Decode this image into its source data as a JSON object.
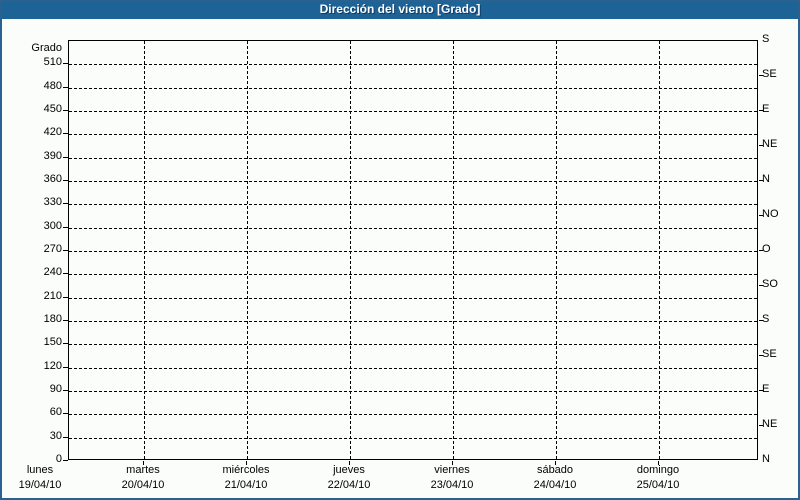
{
  "chart_data": {
    "type": "line",
    "title": "Dirección del viento [Grado]",
    "grid": "dashed",
    "legend": "none",
    "series": [],
    "y_axis": {
      "label": "Grado",
      "min": 0,
      "max": 540,
      "tick_step": 30,
      "tick_labels": [
        0,
        30,
        60,
        90,
        120,
        150,
        180,
        210,
        240,
        270,
        300,
        330,
        360,
        390,
        420,
        450,
        480,
        510
      ]
    },
    "y_axis_right": {
      "tick_step": 45,
      "labels_bottom_to_top": [
        "N",
        "NE",
        "E",
        "SE",
        "S",
        "SO",
        "O",
        "NO",
        "N",
        "NE",
        "E",
        "SE",
        "S"
      ]
    },
    "x_axis": {
      "days": [
        {
          "weekday": "lunes",
          "date": "19/04/10"
        },
        {
          "weekday": "martes",
          "date": "20/04/10"
        },
        {
          "weekday": "miércoles",
          "date": "21/04/10"
        },
        {
          "weekday": "jueves",
          "date": "22/04/10"
        },
        {
          "weekday": "viernes",
          "date": "23/04/10"
        },
        {
          "weekday": "sábado",
          "date": "24/04/10"
        },
        {
          "weekday": "domingo",
          "date": "25/04/10"
        }
      ]
    },
    "colors": {
      "header_bg": "#1E6396",
      "frame_border": "#2B6191",
      "page_bg": "#FBFDFB",
      "axis": "#000000",
      "title_text": "#FFFFFF"
    }
  }
}
